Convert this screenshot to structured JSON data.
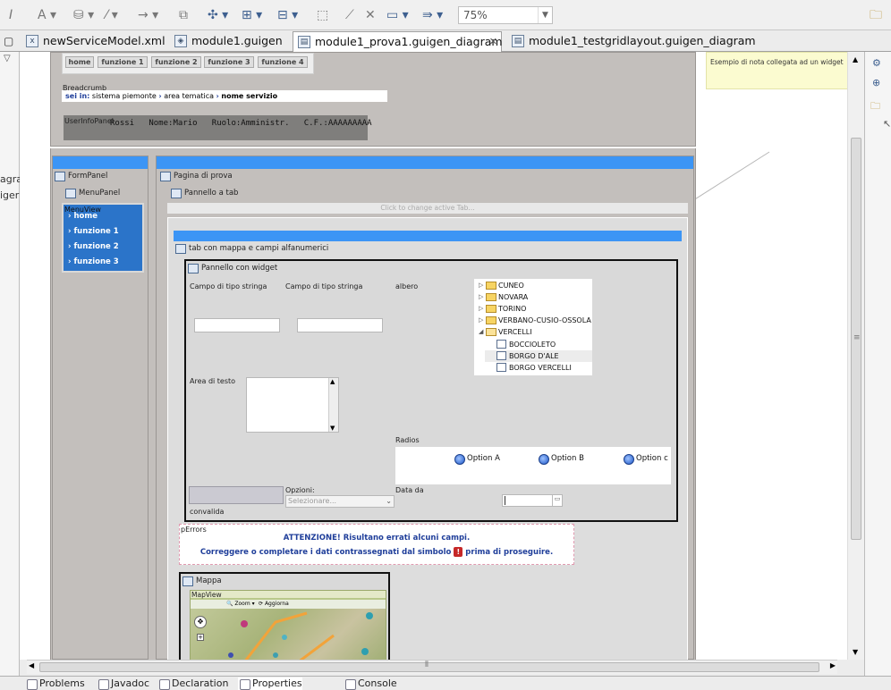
{
  "toolbar": {
    "zoom": "75%"
  },
  "tabs": [
    {
      "label": "newServiceModel.xml"
    },
    {
      "label": "module1.guigen"
    },
    {
      "label": "module1_prova1.guigen_diagram"
    },
    {
      "label": "module1_testgridlayout.guigen_diagram"
    }
  ],
  "left_strip": {
    "text1": "agra",
    "text2": "iger"
  },
  "header": {
    "nav": [
      "home",
      "funzione 1",
      "funzione 2",
      "funzione 3",
      "funzione 4"
    ],
    "breadcrumb_title": "Breadcrumb",
    "breadcrumb_prefix": "sei in:",
    "breadcrumb_items": [
      "sistema piemonte",
      "area tematica",
      "nome servizio"
    ],
    "user_label": "UserInfoPanel",
    "user_info": "Rossi   Nome:Mario   Ruolo:Amministr.   C.F.:AAAAAAAAA"
  },
  "note": "Esempio di nota collegata ad un widget",
  "form_panel": {
    "title": "FormPanel",
    "menu_panel": "MenuPanel",
    "menu_view": "MenuView",
    "menu_items": [
      "home",
      "funzione 1",
      "funzione 2",
      "funzione 3"
    ]
  },
  "page": {
    "title": "Pagina di prova",
    "tab_panel": "Pannello a tab",
    "tab_hint": "Click to change active Tab...",
    "tab_title": "tab con mappa e campi alfanumerici",
    "widget_panel": "Pannello con widget",
    "campo1": "Campo di tipo  stringa",
    "campo2": "Campo di tipo stringa",
    "albero": "albero",
    "area_testo": "Area di testo",
    "radios": "Radios",
    "options": [
      "Option A",
      "Option B",
      "Option c"
    ],
    "opzioni_label": "Opzioni:",
    "opzioni_placeholder": "Selezionare...",
    "data_da": "Data da",
    "convalida": "convalida",
    "tree": [
      {
        "label": "CUNEO",
        "type": "folder"
      },
      {
        "label": "NOVARA",
        "type": "folder"
      },
      {
        "label": "TORINO",
        "type": "folder"
      },
      {
        "label": "VERBANO-CUSIO-OSSOLA",
        "type": "folder"
      },
      {
        "label": "VERCELLI",
        "type": "folder-open"
      },
      {
        "label": "BOCCIOLETO",
        "type": "doc"
      },
      {
        "label": "BORGO D'ALE",
        "type": "doc"
      },
      {
        "label": "BORGO VERCELLI",
        "type": "doc"
      }
    ],
    "errors_label": "pErrors",
    "error_line1": "ATTENZIONE! Risultano errati alcuni campi.",
    "error_line2a": "Correggere o completare i dati contrassegnati dal simbolo",
    "error_line2b": "prima di proseguire.",
    "mappa": "Mappa",
    "map_view": "MapView",
    "map_zoom": "Zoom",
    "map_update": "Aggiorna"
  },
  "bottom_tabs": [
    "Problems",
    "Javadoc",
    "Declaration",
    "Properties",
    "Console"
  ]
}
